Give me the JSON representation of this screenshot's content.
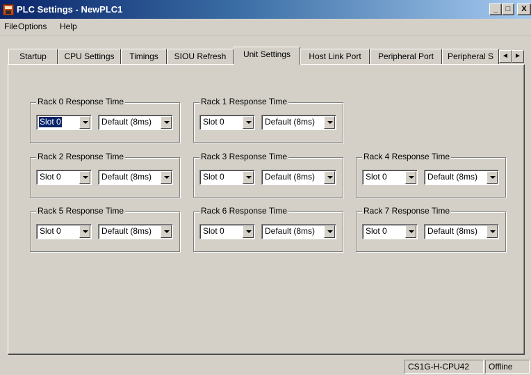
{
  "window": {
    "title": "PLC Settings - NewPLC1",
    "icon": "plc-app-icon",
    "controls": {
      "minimize": "_",
      "maximize": "□",
      "close": "X"
    }
  },
  "menu": [
    {
      "label": "File"
    },
    {
      "label": "Options"
    },
    {
      "label": "Help"
    }
  ],
  "tabs": [
    {
      "label": "Startup"
    },
    {
      "label": "CPU Settings"
    },
    {
      "label": "Timings"
    },
    {
      "label": "SIOU Refresh"
    },
    {
      "label": "Unit Settings",
      "active": true
    },
    {
      "label": "Host Link Port"
    },
    {
      "label": "Peripheral Port"
    },
    {
      "label": "Peripheral S"
    }
  ],
  "tab_scroll": {
    "left": "◄",
    "right": "►"
  },
  "racks": [
    {
      "label": "Rack 0 Response Time",
      "slot": "Slot 0",
      "response": "Default (8ms)"
    },
    {
      "label": "Rack 1 Response Time",
      "slot": "Slot 0",
      "response": "Default (8ms)"
    },
    {
      "label": "Rack 2 Response Time",
      "slot": "Slot 0",
      "response": "Default (8ms)"
    },
    {
      "label": "Rack 3 Response Time",
      "slot": "Slot 0",
      "response": "Default (8ms)"
    },
    {
      "label": "Rack 4 Response Time",
      "slot": "Slot 0",
      "response": "Default (8ms)"
    },
    {
      "label": "Rack 5 Response Time",
      "slot": "Slot 0",
      "response": "Default (8ms)"
    },
    {
      "label": "Rack 6 Response Time",
      "slot": "Slot 0",
      "response": "Default (8ms)"
    },
    {
      "label": "Rack 7 Response Time",
      "slot": "Slot 0",
      "response": "Default (8ms)"
    }
  ],
  "status": {
    "device": "CS1G-H-CPU42",
    "connection": "Offline"
  }
}
